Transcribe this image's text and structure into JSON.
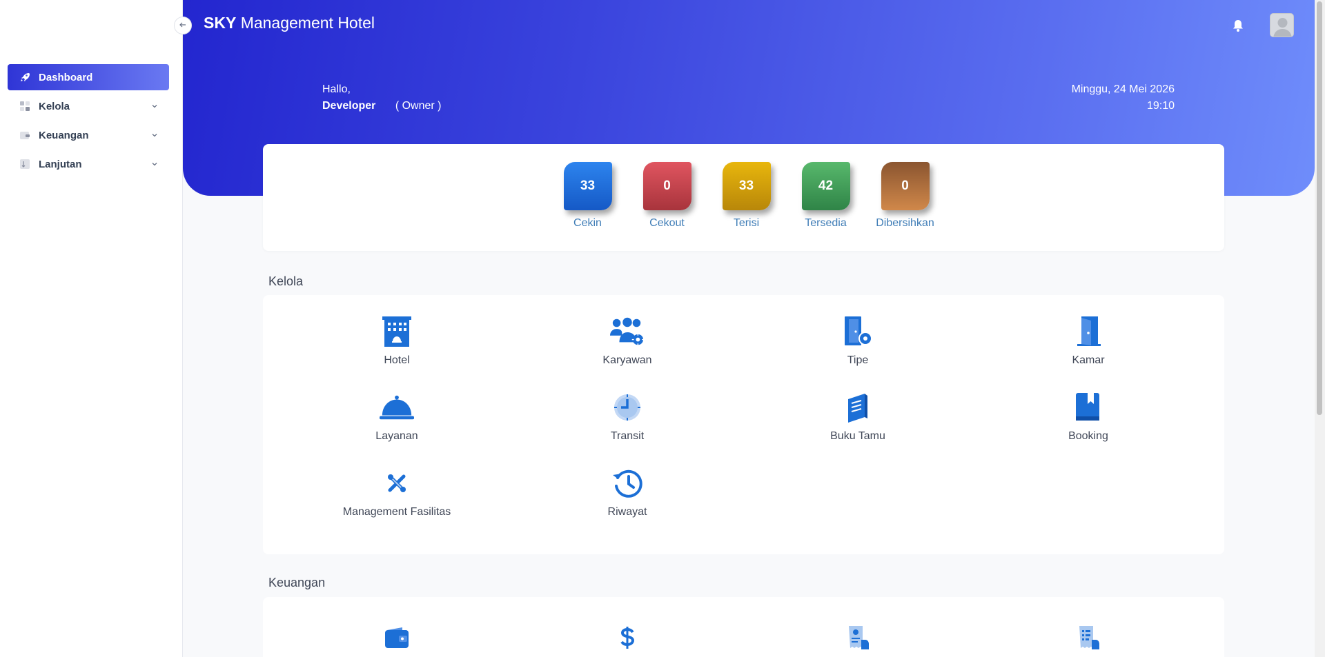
{
  "app": {
    "brand_bold": "SKY",
    "brand_rest": "Management Hotel"
  },
  "sidebar": {
    "items": [
      {
        "label": "Dashboard",
        "icon": "rocket-icon",
        "active": true
      },
      {
        "label": "Kelola",
        "icon": "grid-icon",
        "active": false
      },
      {
        "label": "Keuangan",
        "icon": "wallet-icon",
        "active": false
      },
      {
        "label": "Lanjutan",
        "icon": "sort-icon",
        "active": false
      }
    ]
  },
  "header": {
    "greeting": "Hallo,",
    "user_name": "Developer",
    "user_role": "( Owner )",
    "date": "Minggu, 24 Mei 2026",
    "time": "19:10"
  },
  "stats": [
    {
      "value": "33",
      "label": "Cekin",
      "color": "#1f6fe0"
    },
    {
      "value": "0",
      "label": "Cekout",
      "color": "#c7444d"
    },
    {
      "value": "33",
      "label": "Terisi",
      "color": "#d9a30a"
    },
    {
      "value": "42",
      "label": "Tersedia",
      "color": "#3f9f5a"
    },
    {
      "value": "0",
      "label": "Dibersihkan",
      "color": "#b56a30"
    }
  ],
  "kelola": {
    "title": "Kelola",
    "items": [
      {
        "label": "Hotel",
        "icon": "hotel-icon"
      },
      {
        "label": "Karyawan",
        "icon": "users-cog-icon"
      },
      {
        "label": "Tipe",
        "icon": "door-cog-icon"
      },
      {
        "label": "Kamar",
        "icon": "door-icon"
      },
      {
        "label": "Layanan",
        "icon": "service-bell-icon"
      },
      {
        "label": "Transit",
        "icon": "clock-icon"
      },
      {
        "label": "Buku Tamu",
        "icon": "book-icon"
      },
      {
        "label": "Booking",
        "icon": "bookmark-book-icon"
      },
      {
        "label": "Management Fasilitas",
        "icon": "tools-icon"
      },
      {
        "label": "Riwayat",
        "icon": "history-icon"
      }
    ]
  },
  "keuangan": {
    "title": "Keuangan",
    "items": [
      {
        "icon": "wallet-icon"
      },
      {
        "icon": "dollar-icon"
      },
      {
        "icon": "receipt-hand-icon"
      },
      {
        "icon": "invoice-hand-icon"
      }
    ]
  },
  "colors": {
    "accent": "#2f35d6",
    "icon_blue": "#1c6fd6"
  }
}
